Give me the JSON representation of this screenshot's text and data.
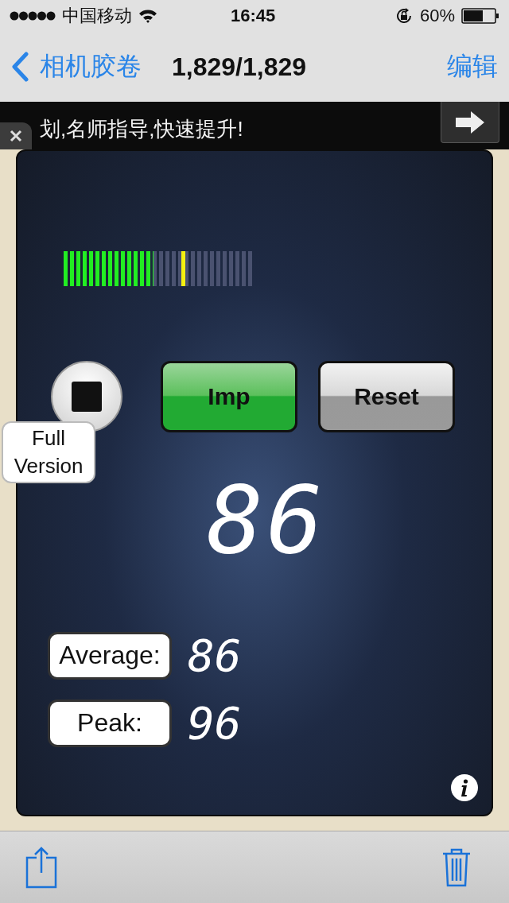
{
  "status_bar": {
    "carrier": "中国移动",
    "time": "16:45",
    "battery": "60%"
  },
  "nav_bar": {
    "back": "相机胶卷",
    "title": "1,829/1,829",
    "action": "编辑"
  },
  "ad_banner": {
    "text": "划,名师指导,快速提升!"
  },
  "meter": {
    "level": 0.47,
    "peak": {
      "level": 0.65
    }
  },
  "imp_button": {
    "label": "Imp"
  },
  "reset_button": {
    "label": "Reset"
  },
  "full_version": {
    "label": "Full Version"
  },
  "reading": "86",
  "stats": [
    {
      "label": "Average:",
      "value": "86"
    },
    {
      "label": "Peak:",
      "value": "96"
    }
  ]
}
